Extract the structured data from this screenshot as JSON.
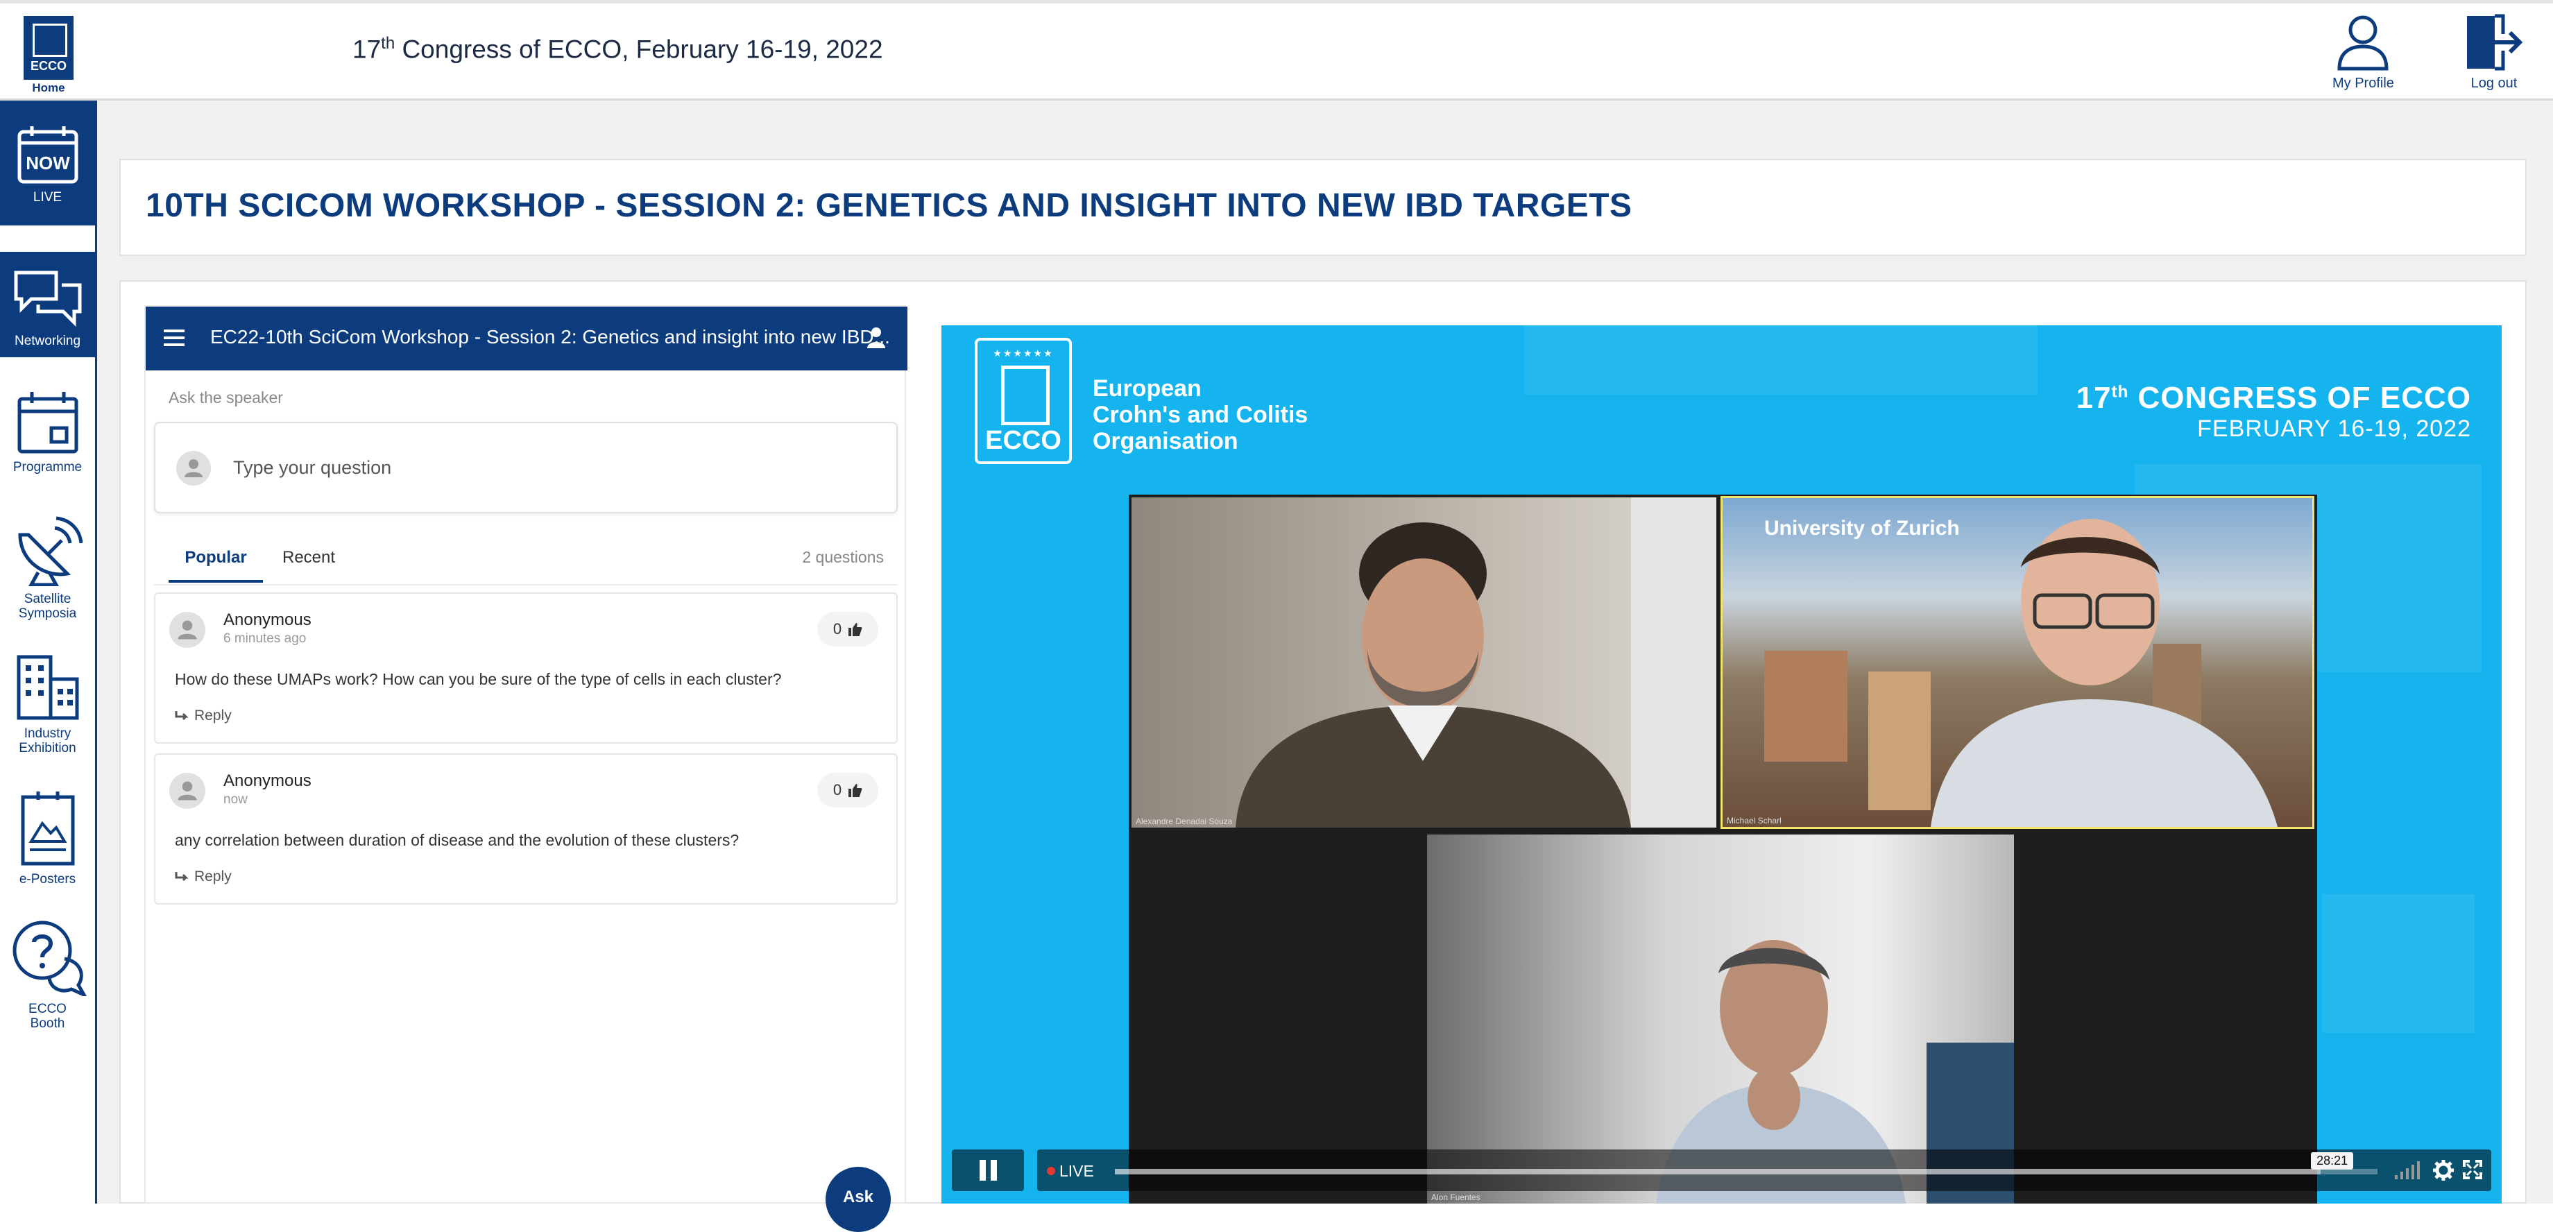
{
  "topbar": {
    "logo_text": "ECCO",
    "home_label": "Home",
    "congress_prefix": "17",
    "congress_sup": "th",
    "congress_rest": " Congress of ECCO, February 16-19, 2022",
    "profile_label": "My Profile",
    "logout_label": "Log out"
  },
  "sidebar": {
    "now_badge": "NOW",
    "items": [
      {
        "label_lines": [
          "LIVE"
        ],
        "icon": "now-live-icon"
      },
      {
        "label_lines": [
          "Networking"
        ],
        "icon": "chat-bubbles-icon"
      },
      {
        "label_lines": [
          "Programme"
        ],
        "icon": "calendar-icon"
      },
      {
        "label_lines": [
          "Satellite",
          "Symposia"
        ],
        "icon": "satellite-dish-icon"
      },
      {
        "label_lines": [
          "Industry",
          "Exhibition"
        ],
        "icon": "buildings-icon"
      },
      {
        "label_lines": [
          "e-Posters"
        ],
        "icon": "poster-board-icon"
      },
      {
        "label_lines": [
          "ECCO",
          "Booth"
        ],
        "icon": "help-chat-icon"
      }
    ]
  },
  "session": {
    "title": "10TH SCICOM WORKSHOP - SESSION 2: GENETICS AND INSIGHT INTO NEW IBD TARGETS"
  },
  "qa": {
    "header_title": "EC22-10th SciCom Workshop - Session 2: Genetics and insight into new IBD...",
    "ask_label": "Ask the speaker",
    "input_placeholder": "Type your question",
    "input_value": "",
    "tabs": [
      "Popular",
      "Recent"
    ],
    "active_tab": "Popular",
    "question_count": "2 questions",
    "reply_label": "Reply",
    "ask_button": "Ask",
    "questions": [
      {
        "author": "Anonymous",
        "time": "6 minutes ago",
        "likes": "0",
        "text": "How do these UMAPs work? How can you be sure of the type of cells in each cluster?"
      },
      {
        "author": "Anonymous",
        "time": "now",
        "likes": "0",
        "text": "any correlation between duration of disease and the evolution of these clusters?"
      }
    ]
  },
  "video": {
    "org_logo_text": "ECCO",
    "org_name_lines": [
      "European",
      "Crohn's and Colitis",
      "Organisation"
    ],
    "congress_num": "17",
    "congress_sup": "th",
    "congress_text": " CONGRESS OF ECCO",
    "congress_dates": "FEBRUARY 16-19, 2022",
    "participants": [
      {
        "name": "Alexandre Denadai Souza"
      },
      {
        "name": "Michael Scharl",
        "background_text": "University of Zurich"
      },
      {
        "name": "Alon Fuentes"
      }
    ],
    "live_label": "LIVE",
    "time_tooltip": "28:21",
    "progress": 0.955,
    "colors": {
      "stage": "#16b4ef",
      "brand": "#0c3c7d"
    }
  }
}
